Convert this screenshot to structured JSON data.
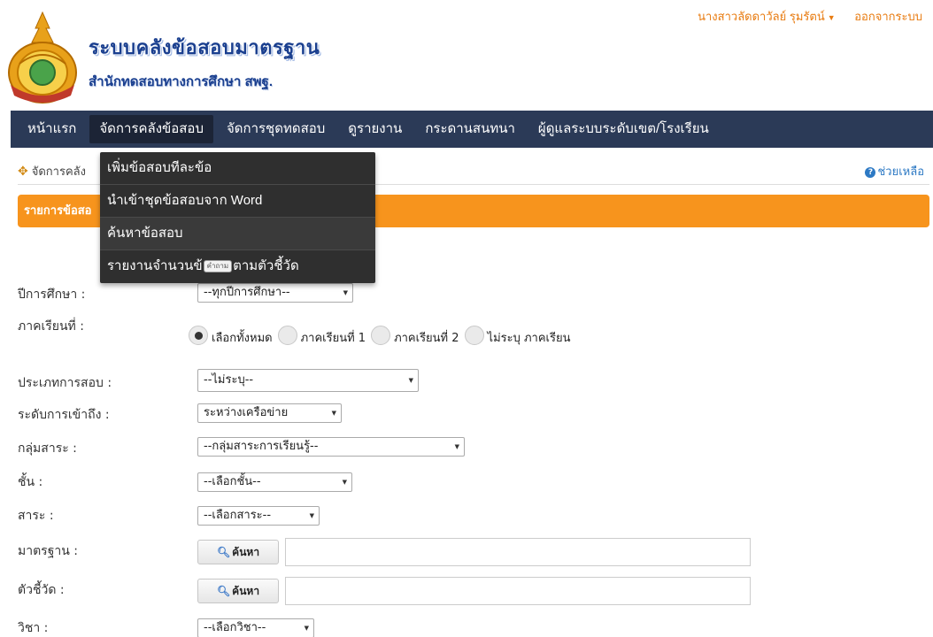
{
  "header": {
    "title": "ระบบคลังข้อสอบมาตรฐาน",
    "subtitle": "สำนักทดสอบทางการศึกษา สพฐ.",
    "user_name": "นางสาวลัดดาวัลย์ รุมรัตน์",
    "logout": "ออกจากระบบ",
    "logo_icon": "obec-emblem-icon"
  },
  "navbar": {
    "items": [
      {
        "label": "หน้าแรก"
      },
      {
        "label": "จัดการคลังข้อสอบ"
      },
      {
        "label": "จัดการชุดทดสอบ"
      },
      {
        "label": "ดูรายงาน"
      },
      {
        "label": "กระดานสนทนา"
      },
      {
        "label": "ผู้ดูแลระบบระดับเขต/โรงเรียน"
      }
    ],
    "active_index": 1,
    "bg_color": "#2b3a57"
  },
  "dropdown": {
    "items": [
      {
        "label": "เพิ่มข้อสอบทีละข้อ"
      },
      {
        "label": "นำเข้าชุดข้อสอบจาก Word"
      },
      {
        "label": "ค้นหาข้อสอบ"
      },
      {
        "label_before": "รายงานจำนวนข้",
        "label_after": "ตามตัวชี้วัด"
      }
    ],
    "tooltip": "คำถาม"
  },
  "breadcrumb": {
    "text": "จัดการคลัง",
    "help": "ช่วยเหลือ"
  },
  "section_bar": {
    "title": "รายการข้อสอ",
    "color": "#f7941d"
  },
  "form": {
    "year": {
      "label": "ปีการศึกษา :",
      "value": "--ทุกปีการศึกษา--"
    },
    "semester": {
      "label": "ภาคเรียนที่ :",
      "options": [
        "เลือกทั้งหมด",
        "ภาคเรียนที่ 1",
        "ภาคเรียนที่ 2",
        "ไม่ระบุ ภาคเรียน"
      ],
      "selected_index": 0
    },
    "exam_type": {
      "label": "ประเภทการสอบ :",
      "value": "--ไม่ระบุ--"
    },
    "access_level": {
      "label": "ระดับการเข้าถึง :",
      "value": "ระหว่างเครือข่าย"
    },
    "subject_group": {
      "label": "กลุ่มสาระ :",
      "value": "--กลุ่มสาระการเรียนรู้--"
    },
    "grade": {
      "label": "ชั้น :",
      "value": "--เลือกชั้น--"
    },
    "strand": {
      "label": "สาระ :",
      "value": "--เลือกสาระ--"
    },
    "standard": {
      "label": "มาตรฐาน :",
      "button": "ค้นหา",
      "value": ""
    },
    "indicator": {
      "label": "ตัวชี้วัด :",
      "button": "ค้นหา",
      "value": ""
    },
    "course": {
      "label": "วิชา :",
      "value": "--เลือกวิชา--"
    }
  }
}
